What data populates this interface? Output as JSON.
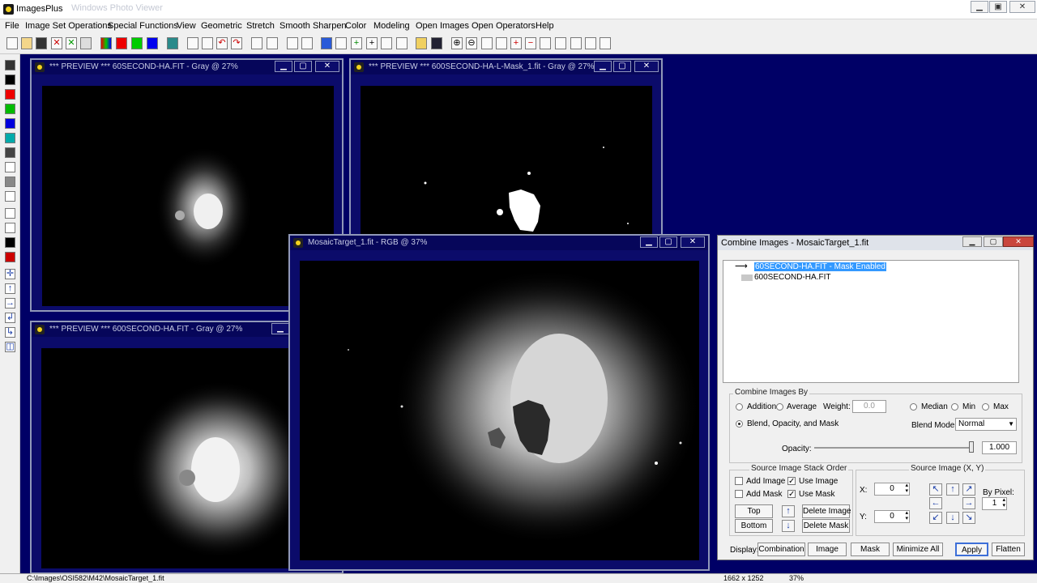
{
  "app": {
    "title": "ImagesPlus",
    "ghost_title": "Windows Photo Viewer"
  },
  "menu": [
    "File",
    "Image Set Operations",
    "Special Functions",
    "View",
    "Geometric",
    "Stretch",
    "Smooth Sharpen",
    "Color",
    "Modeling",
    "Open Images",
    "Open Operators",
    "Help"
  ],
  "windows": {
    "preview1": {
      "title": "*** PREVIEW *** 60SECOND-HA.FIT - Gray @ 27%"
    },
    "preview2": {
      "title": "*** PREVIEW *** 600SECOND-HA-L-Mask_1.fit - Gray @ 27%"
    },
    "preview3": {
      "title": "*** PREVIEW *** 600SECOND-HA.FIT - Gray @ 27%"
    },
    "mosaic": {
      "title": "MosaicTarget_1.fit - RGB @ 37%"
    }
  },
  "panel": {
    "title": "Combine Images - MosaicTarget_1.fit",
    "layers": [
      "60SECOND-HA.FIT - Mask Enabled",
      "600SECOND-HA.FIT"
    ],
    "combine_by": {
      "label": "Combine Images By",
      "addition": "Addition",
      "average": "Average",
      "weight_label": "Weight:",
      "weight_value": "0.0",
      "median": "Median",
      "min": "Min",
      "max": "Max",
      "blend": "Blend, Opacity, and Mask",
      "blend_mode_label": "Blend Mode:",
      "blend_mode": "Normal",
      "opacity_label": "Opacity:",
      "opacity_value": "1.000",
      "opacity_fraction": 1.0
    },
    "stack_order": {
      "label": "Source Image Stack Order",
      "add_image": "Add Image",
      "use_image": "Use Image",
      "add_mask": "Add Mask",
      "use_mask": "Use Mask",
      "top": "Top",
      "bottom": "Bottom",
      "delete_image": "Delete Image",
      "delete_mask": "Delete Mask"
    },
    "source_xy": {
      "label": "Source Image (X, Y)",
      "x_label": "X:",
      "x_value": "0",
      "y_label": "Y:",
      "y_value": "0",
      "by_pixel_label": "By Pixel:",
      "by_pixel_value": "1"
    },
    "display": {
      "label": "Display:",
      "combination": "Combination",
      "image": "Image",
      "mask": "Mask",
      "minimize_all": "Minimize All",
      "apply": "Apply",
      "flatten": "Flatten"
    }
  },
  "status": {
    "path": "C:\\Images\\OSI582\\M42\\MosaicTarget_1.fit",
    "dims": "1662 x 1252",
    "zoom": "37%"
  }
}
